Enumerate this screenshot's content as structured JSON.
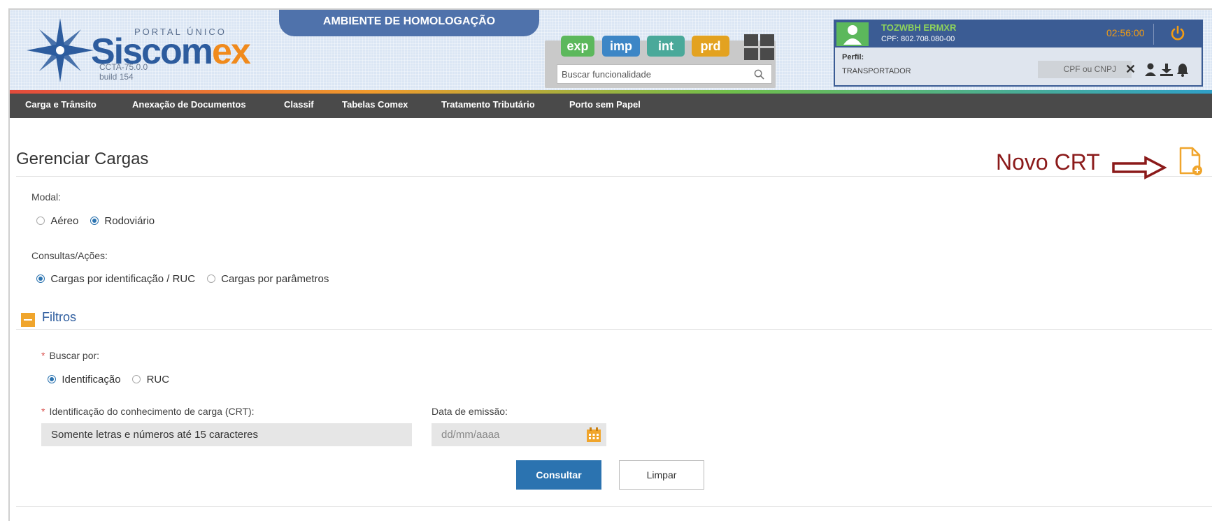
{
  "header": {
    "portal_label": "PORTAL ÚNICO",
    "brand_main": "Siscom",
    "brand_accent": "ex",
    "version": "CCTA-75.0.0",
    "build": "build 154",
    "environment": "AMBIENTE DE HOMOLOGAÇÃO",
    "env_buttons": [
      {
        "label": "exp",
        "color": "#5cb85c"
      },
      {
        "label": "imp",
        "color": "#3d86c6"
      },
      {
        "label": "int",
        "color": "#4aa99a"
      },
      {
        "label": "prd",
        "color": "#e3a220"
      }
    ],
    "search_placeholder": "Buscar funcionalidade",
    "user": {
      "name": "TOZWBH ERMXR",
      "cpf": "CPF: 802.708.080-00",
      "timer": "02:56:00",
      "perfil_label": "Perfil:",
      "perfil_value": "TRANSPORTADOR",
      "cpf_cnpj_placeholder": "CPF ou CNPJ"
    },
    "icons": [
      "star-logo-icon",
      "grid-icon",
      "search-icon",
      "user-avatar-icon",
      "power-icon",
      "close-icon",
      "person-icon",
      "download-icon",
      "bell-icon"
    ]
  },
  "nav": {
    "items": [
      "Carga e Trânsito",
      "Anexação de Documentos",
      "Classif",
      "Tabelas Comex",
      "Tratamento Tributário",
      "Porto sem Papel"
    ]
  },
  "page": {
    "title": "Gerenciar Cargas",
    "annotation": "Novo CRT",
    "modal_label": "Modal:",
    "modal_options": [
      {
        "label": "Aéreo",
        "selected": false
      },
      {
        "label": "Rodoviário",
        "selected": true
      }
    ],
    "consultas_label": "Consultas/Ações:",
    "consultas_options": [
      {
        "label": "Cargas por identificação / RUC",
        "selected": true
      },
      {
        "label": "Cargas por parâmetros",
        "selected": false
      }
    ],
    "filtros_title": "Filtros",
    "buscar_label": "Buscar por:",
    "buscar_options": [
      {
        "label": "Identificação",
        "selected": true
      },
      {
        "label": "RUC",
        "selected": false
      }
    ],
    "ident_label": "Identificação do conhecimento de carga (CRT):",
    "ident_placeholder": "Somente letras e números até 15 caracteres",
    "data_label": "Data de emissão:",
    "data_placeholder": "dd/mm/aaaa",
    "btn_consultar": "Consultar",
    "btn_limpar": "Limpar"
  },
  "colors": {
    "primary": "#2b73b0",
    "accent": "#f08a1c",
    "annotation": "#8b1a1a",
    "nav_bg": "#4a4a4a"
  }
}
